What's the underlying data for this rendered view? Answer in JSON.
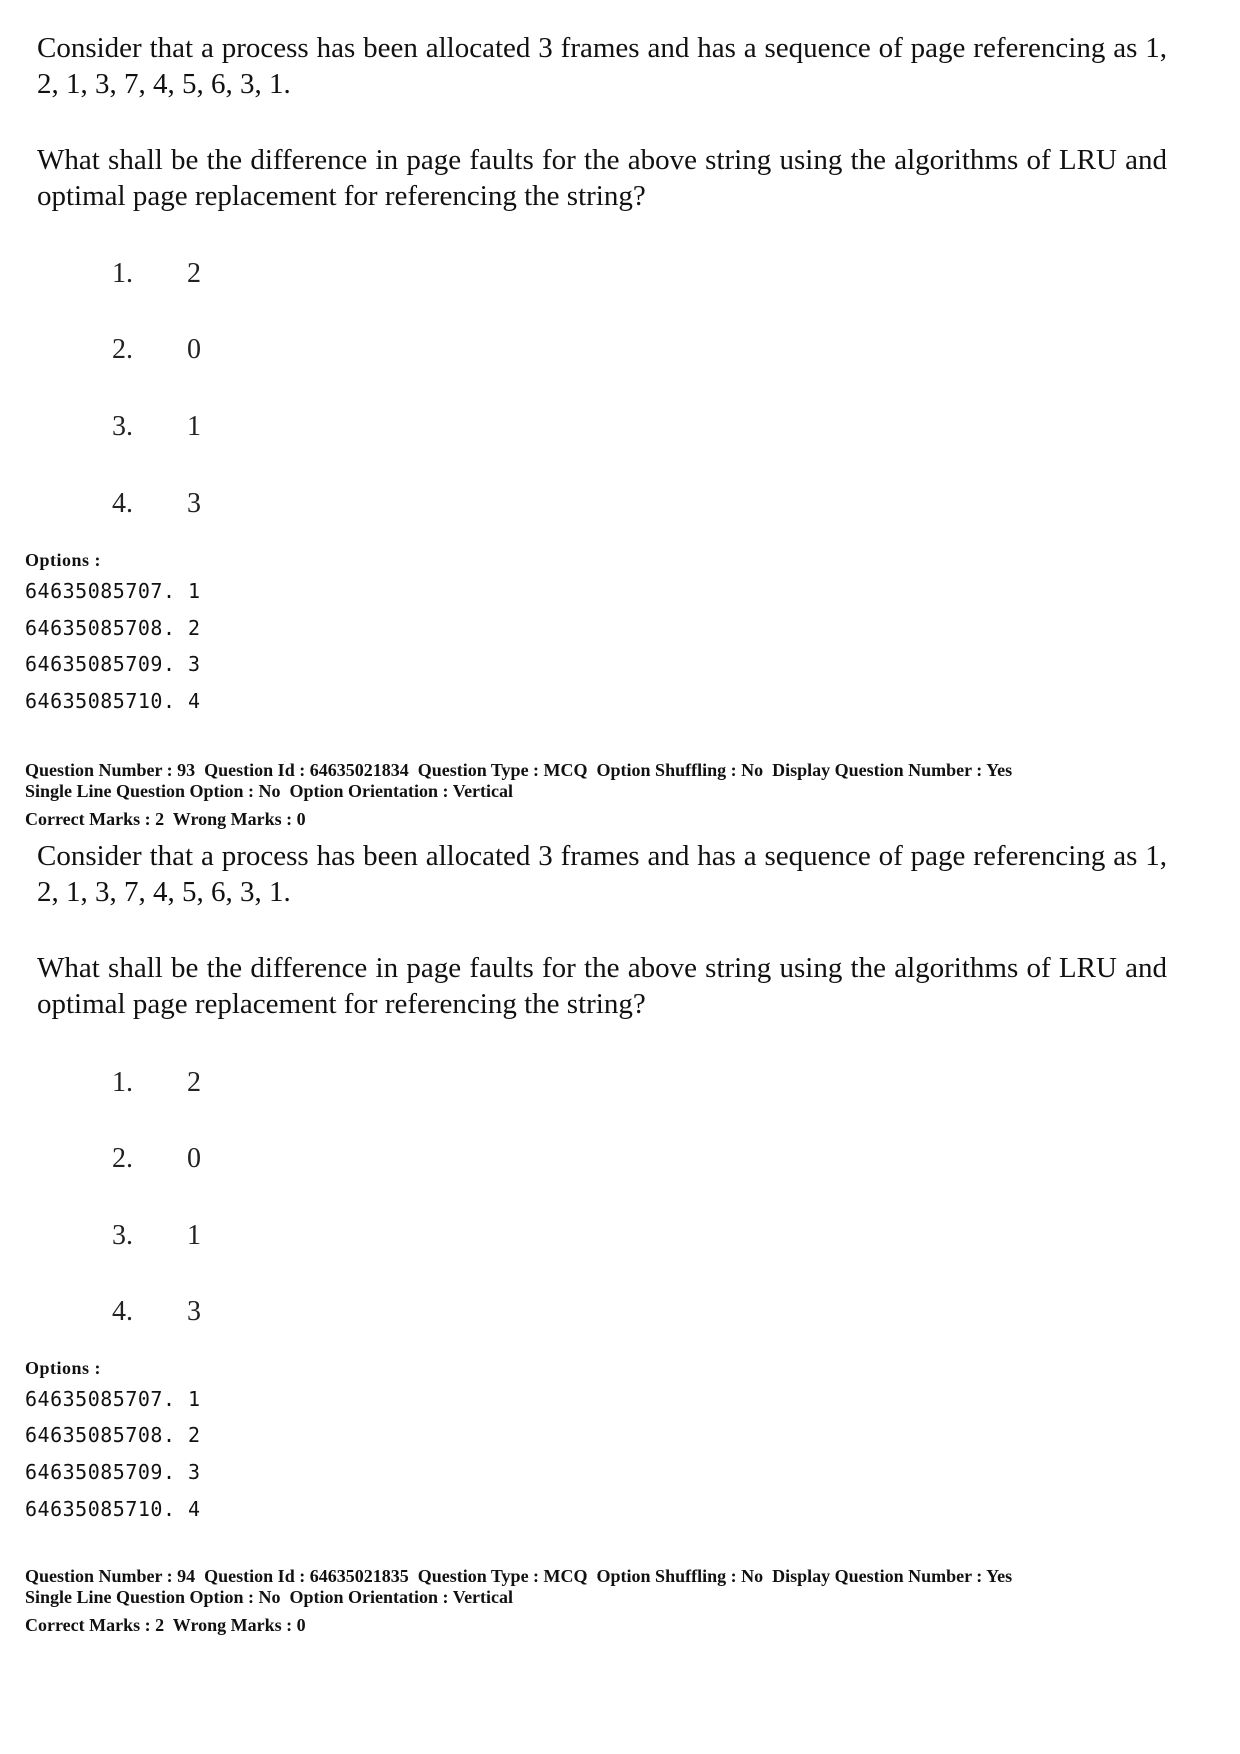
{
  "blocks": [
    {
      "question_text_1": "Consider that a process has been allocated 3 frames and has a sequence of page referencing as 1, 2, 1, 3, 7, 4, 5, 6, 3, 1.",
      "question_text_2": "What shall be the difference in page faults for the above string using the algorithms of LRU and optimal page replacement for referencing the string?",
      "choices": [
        {
          "num": "1.",
          "value": "2"
        },
        {
          "num": "2.",
          "value": "0"
        },
        {
          "num": "3.",
          "value": "1"
        },
        {
          "num": "4.",
          "value": "3"
        }
      ],
      "options_label": "Options :",
      "options": [
        "64635085707. 1",
        "64635085708. 2",
        "64635085709. 3",
        "64635085710. 4"
      ]
    },
    {
      "meta_line_1": "Question Number : 93  Question Id : 64635021834  Question Type : MCQ  Option Shuffling : No  Display Question Number : Yes",
      "meta_line_2": "Single Line Question Option : No  Option Orientation : Vertical",
      "meta_line_3": "Correct Marks : 2  Wrong Marks : 0",
      "question_text_1": "Consider that a process has been allocated 3 frames and has a sequence of page referencing as 1, 2, 1, 3, 7, 4, 5, 6, 3, 1.",
      "question_text_2": "What shall be the difference in page faults for the above string using the algorithms of LRU and optimal page replacement for referencing the string?",
      "choices": [
        {
          "num": "1.",
          "value": "2"
        },
        {
          "num": "2.",
          "value": "0"
        },
        {
          "num": "3.",
          "value": "1"
        },
        {
          "num": "4.",
          "value": "3"
        }
      ],
      "options_label": "Options :",
      "options": [
        "64635085707. 1",
        "64635085708. 2",
        "64635085709. 3",
        "64635085710. 4"
      ]
    },
    {
      "meta_line_1": "Question Number : 94  Question Id : 64635021835  Question Type : MCQ  Option Shuffling : No  Display Question Number : Yes",
      "meta_line_2": "Single Line Question Option : No  Option Orientation : Vertical",
      "meta_line_3": "Correct Marks : 2  Wrong Marks : 0"
    }
  ]
}
